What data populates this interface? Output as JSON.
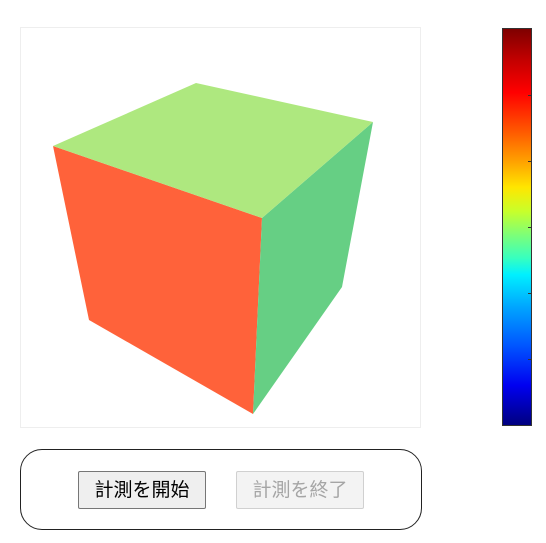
{
  "viewer": {
    "object": "cube",
    "faces": {
      "top": "#aee87f",
      "front": "#ff623a",
      "right": "#66cf84"
    }
  },
  "colorbar": {
    "scale": "jet",
    "tick_count": 7
  },
  "controls": {
    "start_label": "計測を開始",
    "stop_label": "計測を終了",
    "stop_disabled": true
  }
}
